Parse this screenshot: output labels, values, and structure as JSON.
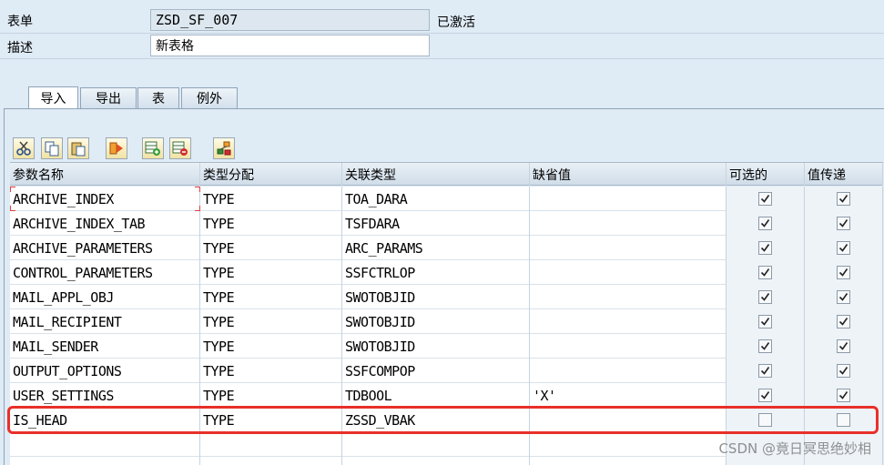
{
  "header": {
    "form_label": "表单",
    "form_value": "ZSD_SF_007",
    "status": "已激活",
    "desc_label": "描述",
    "desc_value": "新表格"
  },
  "tabs": [
    {
      "label": "导入",
      "active": true
    },
    {
      "label": "导出",
      "active": false
    },
    {
      "label": "表",
      "active": false
    },
    {
      "label": "例外",
      "active": false
    }
  ],
  "toolbar": {
    "icons": [
      "cut-icon",
      "copy-icon",
      "paste-icon",
      "move-icon",
      "insert-row-icon",
      "delete-row-icon",
      "hierarchy-icon"
    ]
  },
  "grid": {
    "columns": [
      "参数名称",
      "类型分配",
      "关联类型",
      "缺省值",
      "可选的",
      "值传递"
    ],
    "rows": [
      {
        "name": "ARCHIVE_INDEX",
        "typing": "TYPE",
        "ref_type": "TOA_DARA",
        "default": "",
        "optional": true,
        "by_value": true
      },
      {
        "name": "ARCHIVE_INDEX_TAB",
        "typing": "TYPE",
        "ref_type": "TSFDARA",
        "default": "",
        "optional": true,
        "by_value": true
      },
      {
        "name": "ARCHIVE_PARAMETERS",
        "typing": "TYPE",
        "ref_type": "ARC_PARAMS",
        "default": "",
        "optional": true,
        "by_value": true
      },
      {
        "name": "CONTROL_PARAMETERS",
        "typing": "TYPE",
        "ref_type": "SSFCTRLOP",
        "default": "",
        "optional": true,
        "by_value": true
      },
      {
        "name": "MAIL_APPL_OBJ",
        "typing": "TYPE",
        "ref_type": "SWOTOBJID",
        "default": "",
        "optional": true,
        "by_value": true
      },
      {
        "name": "MAIL_RECIPIENT",
        "typing": "TYPE",
        "ref_type": "SWOTOBJID",
        "default": "",
        "optional": true,
        "by_value": true
      },
      {
        "name": "MAIL_SENDER",
        "typing": "TYPE",
        "ref_type": "SWOTOBJID",
        "default": "",
        "optional": true,
        "by_value": true
      },
      {
        "name": "OUTPUT_OPTIONS",
        "typing": "TYPE",
        "ref_type": "SSFCOMPOP",
        "default": "",
        "optional": true,
        "by_value": true
      },
      {
        "name": "USER_SETTINGS",
        "typing": "TYPE",
        "ref_type": "TDBOOL",
        "default": "'X'",
        "optional": true,
        "by_value": true
      },
      {
        "name": "IS_HEAD",
        "typing": "TYPE",
        "ref_type": "ZSSD_VBAK",
        "default": "",
        "optional": false,
        "by_value": false
      },
      {
        "name": "",
        "typing": "",
        "ref_type": "",
        "default": "",
        "optional": null,
        "by_value": null
      },
      {
        "name": "",
        "typing": "",
        "ref_type": "",
        "default": "",
        "optional": null,
        "by_value": null
      }
    ]
  },
  "watermark": "CSDN @竟日冥思绝妙相",
  "colors": {
    "highlight": "#e8302a",
    "background": "#dfebf5"
  }
}
